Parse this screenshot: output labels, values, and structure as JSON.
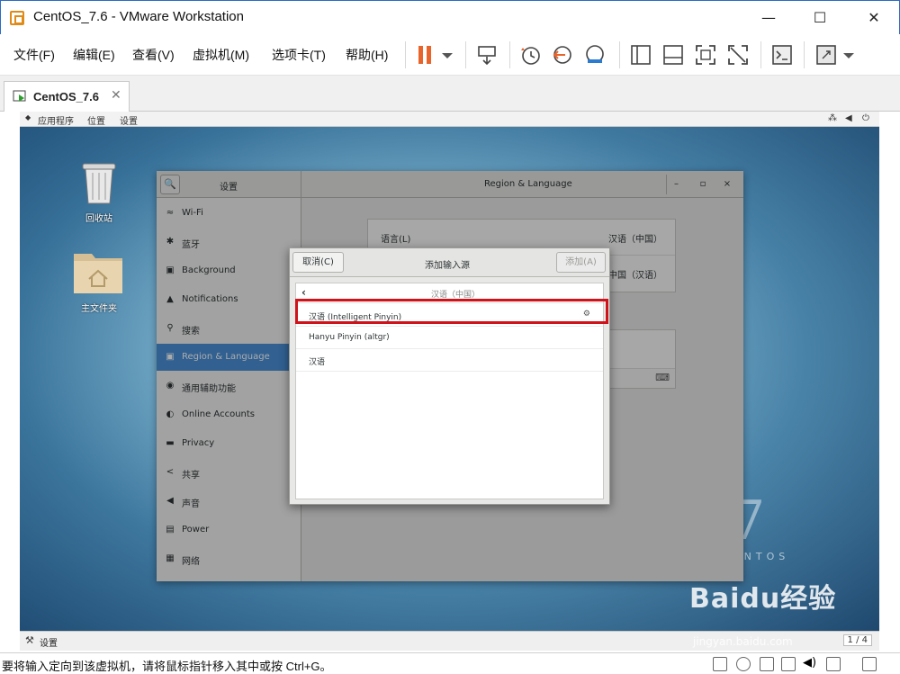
{
  "window": {
    "title": "CentOS_7.6 - VMware Workstation",
    "minimize": "—",
    "maximize": "☐",
    "close": "✕"
  },
  "menubar": {
    "items": [
      "文件(F)",
      "编辑(E)",
      "查看(V)",
      "虚拟机(M)",
      "选项卡(T)",
      "帮助(H)"
    ]
  },
  "tab": {
    "label": "CentOS_7.6",
    "close": "✕"
  },
  "gnome_bar": {
    "applications": "应用程序",
    "places": "位置",
    "settings": "设置"
  },
  "desktop_icons": {
    "trash": "回收站",
    "home": "主文件夹"
  },
  "centos_logo": {
    "number": "7",
    "text": "CENTOS"
  },
  "settings": {
    "search_icon": "🔍",
    "sidebar_title": "设置",
    "main_title": "Region & Language",
    "minimize": "–",
    "maximize": "▫",
    "close": "×",
    "sidebar_items": [
      {
        "icon": "wifi-icon",
        "glyph": "≈",
        "label": "Wi-Fi"
      },
      {
        "icon": "bluetooth-icon",
        "glyph": "✱",
        "label": "蓝牙"
      },
      {
        "icon": "background-icon",
        "glyph": "▣",
        "label": "Background"
      },
      {
        "icon": "notifications-icon",
        "glyph": "▲",
        "label": "Notifications"
      },
      {
        "icon": "search-icon",
        "glyph": "⚲",
        "label": "搜索"
      },
      {
        "icon": "region-icon",
        "glyph": "▣",
        "label": "Region & Language"
      },
      {
        "icon": "accessibility-icon",
        "glyph": "◉",
        "label": "通用辅助功能"
      },
      {
        "icon": "online-accounts-icon",
        "glyph": "◐",
        "label": "Online Accounts"
      },
      {
        "icon": "privacy-icon",
        "glyph": "▬",
        "label": "Privacy"
      },
      {
        "icon": "share-icon",
        "glyph": "<",
        "label": "共享"
      },
      {
        "icon": "sound-icon",
        "glyph": "◀",
        "label": "声音"
      },
      {
        "icon": "power-icon",
        "glyph": "▤",
        "label": "Power"
      },
      {
        "icon": "network-icon",
        "glyph": "▦",
        "label": "网络"
      }
    ],
    "active_index": 5,
    "language_label": "语言(L)",
    "language_value": "汉语（中国）",
    "formats_value": "中国（汉语）",
    "keyboard_glyph": "⌨"
  },
  "dialog": {
    "cancel": "取消(C)",
    "title": "添加输入源",
    "add": "添加(A)",
    "back_chevron": "‹",
    "breadcrumb": "汉语（中国）",
    "rows": [
      {
        "label": "汉语 (Intelligent Pinyin)",
        "gear": "⚙"
      },
      {
        "label": "Hanyu Pinyin (altgr)"
      },
      {
        "label": "汉语"
      }
    ]
  },
  "guest_taskbar": {
    "label": "设置",
    "page": "1 / 4"
  },
  "statusbar": {
    "text": "要将输入定向到该虚拟机，请将鼠标指针移入其中或按 Ctrl+G。"
  },
  "watermark": {
    "logo": "Baidu经验",
    "url": "jingyan.baidu.com"
  },
  "colors": {
    "accent": "#4a90d9",
    "highlight": "#d0121b",
    "pause": "#e8642b"
  }
}
